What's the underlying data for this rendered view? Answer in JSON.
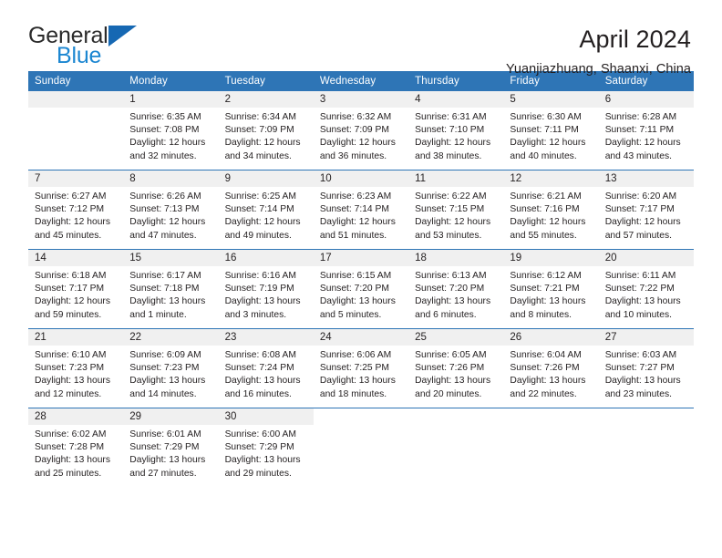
{
  "brand": {
    "name_part1": "General",
    "name_part2": "Blue"
  },
  "header": {
    "title": "April 2024",
    "subtitle": "Yuanjiazhuang, Shaanxi, China"
  },
  "colors": {
    "header_blue": "#2e75b6",
    "logo_blue": "#1b86d1",
    "daynum_band": "#f0f0f0",
    "text": "#231f20"
  },
  "calendar": {
    "weekday_headers": [
      "Sunday",
      "Monday",
      "Tuesday",
      "Wednesday",
      "Thursday",
      "Friday",
      "Saturday"
    ],
    "weeks": [
      [
        {
          "day": "",
          "lines": []
        },
        {
          "day": "1",
          "lines": [
            "Sunrise: 6:35 AM",
            "Sunset: 7:08 PM",
            "Daylight: 12 hours",
            "and 32 minutes."
          ]
        },
        {
          "day": "2",
          "lines": [
            "Sunrise: 6:34 AM",
            "Sunset: 7:09 PM",
            "Daylight: 12 hours",
            "and 34 minutes."
          ]
        },
        {
          "day": "3",
          "lines": [
            "Sunrise: 6:32 AM",
            "Sunset: 7:09 PM",
            "Daylight: 12 hours",
            "and 36 minutes."
          ]
        },
        {
          "day": "4",
          "lines": [
            "Sunrise: 6:31 AM",
            "Sunset: 7:10 PM",
            "Daylight: 12 hours",
            "and 38 minutes."
          ]
        },
        {
          "day": "5",
          "lines": [
            "Sunrise: 6:30 AM",
            "Sunset: 7:11 PM",
            "Daylight: 12 hours",
            "and 40 minutes."
          ]
        },
        {
          "day": "6",
          "lines": [
            "Sunrise: 6:28 AM",
            "Sunset: 7:11 PM",
            "Daylight: 12 hours",
            "and 43 minutes."
          ]
        }
      ],
      [
        {
          "day": "7",
          "lines": [
            "Sunrise: 6:27 AM",
            "Sunset: 7:12 PM",
            "Daylight: 12 hours",
            "and 45 minutes."
          ]
        },
        {
          "day": "8",
          "lines": [
            "Sunrise: 6:26 AM",
            "Sunset: 7:13 PM",
            "Daylight: 12 hours",
            "and 47 minutes."
          ]
        },
        {
          "day": "9",
          "lines": [
            "Sunrise: 6:25 AM",
            "Sunset: 7:14 PM",
            "Daylight: 12 hours",
            "and 49 minutes."
          ]
        },
        {
          "day": "10",
          "lines": [
            "Sunrise: 6:23 AM",
            "Sunset: 7:14 PM",
            "Daylight: 12 hours",
            "and 51 minutes."
          ]
        },
        {
          "day": "11",
          "lines": [
            "Sunrise: 6:22 AM",
            "Sunset: 7:15 PM",
            "Daylight: 12 hours",
            "and 53 minutes."
          ]
        },
        {
          "day": "12",
          "lines": [
            "Sunrise: 6:21 AM",
            "Sunset: 7:16 PM",
            "Daylight: 12 hours",
            "and 55 minutes."
          ]
        },
        {
          "day": "13",
          "lines": [
            "Sunrise: 6:20 AM",
            "Sunset: 7:17 PM",
            "Daylight: 12 hours",
            "and 57 minutes."
          ]
        }
      ],
      [
        {
          "day": "14",
          "lines": [
            "Sunrise: 6:18 AM",
            "Sunset: 7:17 PM",
            "Daylight: 12 hours",
            "and 59 minutes."
          ]
        },
        {
          "day": "15",
          "lines": [
            "Sunrise: 6:17 AM",
            "Sunset: 7:18 PM",
            "Daylight: 13 hours",
            "and 1 minute."
          ]
        },
        {
          "day": "16",
          "lines": [
            "Sunrise: 6:16 AM",
            "Sunset: 7:19 PM",
            "Daylight: 13 hours",
            "and 3 minutes."
          ]
        },
        {
          "day": "17",
          "lines": [
            "Sunrise: 6:15 AM",
            "Sunset: 7:20 PM",
            "Daylight: 13 hours",
            "and 5 minutes."
          ]
        },
        {
          "day": "18",
          "lines": [
            "Sunrise: 6:13 AM",
            "Sunset: 7:20 PM",
            "Daylight: 13 hours",
            "and 6 minutes."
          ]
        },
        {
          "day": "19",
          "lines": [
            "Sunrise: 6:12 AM",
            "Sunset: 7:21 PM",
            "Daylight: 13 hours",
            "and 8 minutes."
          ]
        },
        {
          "day": "20",
          "lines": [
            "Sunrise: 6:11 AM",
            "Sunset: 7:22 PM",
            "Daylight: 13 hours",
            "and 10 minutes."
          ]
        }
      ],
      [
        {
          "day": "21",
          "lines": [
            "Sunrise: 6:10 AM",
            "Sunset: 7:23 PM",
            "Daylight: 13 hours",
            "and 12 minutes."
          ]
        },
        {
          "day": "22",
          "lines": [
            "Sunrise: 6:09 AM",
            "Sunset: 7:23 PM",
            "Daylight: 13 hours",
            "and 14 minutes."
          ]
        },
        {
          "day": "23",
          "lines": [
            "Sunrise: 6:08 AM",
            "Sunset: 7:24 PM",
            "Daylight: 13 hours",
            "and 16 minutes."
          ]
        },
        {
          "day": "24",
          "lines": [
            "Sunrise: 6:06 AM",
            "Sunset: 7:25 PM",
            "Daylight: 13 hours",
            "and 18 minutes."
          ]
        },
        {
          "day": "25",
          "lines": [
            "Sunrise: 6:05 AM",
            "Sunset: 7:26 PM",
            "Daylight: 13 hours",
            "and 20 minutes."
          ]
        },
        {
          "day": "26",
          "lines": [
            "Sunrise: 6:04 AM",
            "Sunset: 7:26 PM",
            "Daylight: 13 hours",
            "and 22 minutes."
          ]
        },
        {
          "day": "27",
          "lines": [
            "Sunrise: 6:03 AM",
            "Sunset: 7:27 PM",
            "Daylight: 13 hours",
            "and 23 minutes."
          ]
        }
      ],
      [
        {
          "day": "28",
          "lines": [
            "Sunrise: 6:02 AM",
            "Sunset: 7:28 PM",
            "Daylight: 13 hours",
            "and 25 minutes."
          ]
        },
        {
          "day": "29",
          "lines": [
            "Sunrise: 6:01 AM",
            "Sunset: 7:29 PM",
            "Daylight: 13 hours",
            "and 27 minutes."
          ]
        },
        {
          "day": "30",
          "lines": [
            "Sunrise: 6:00 AM",
            "Sunset: 7:29 PM",
            "Daylight: 13 hours",
            "and 29 minutes."
          ]
        },
        {
          "day": "",
          "lines": []
        },
        {
          "day": "",
          "lines": []
        },
        {
          "day": "",
          "lines": []
        },
        {
          "day": "",
          "lines": []
        }
      ]
    ]
  }
}
